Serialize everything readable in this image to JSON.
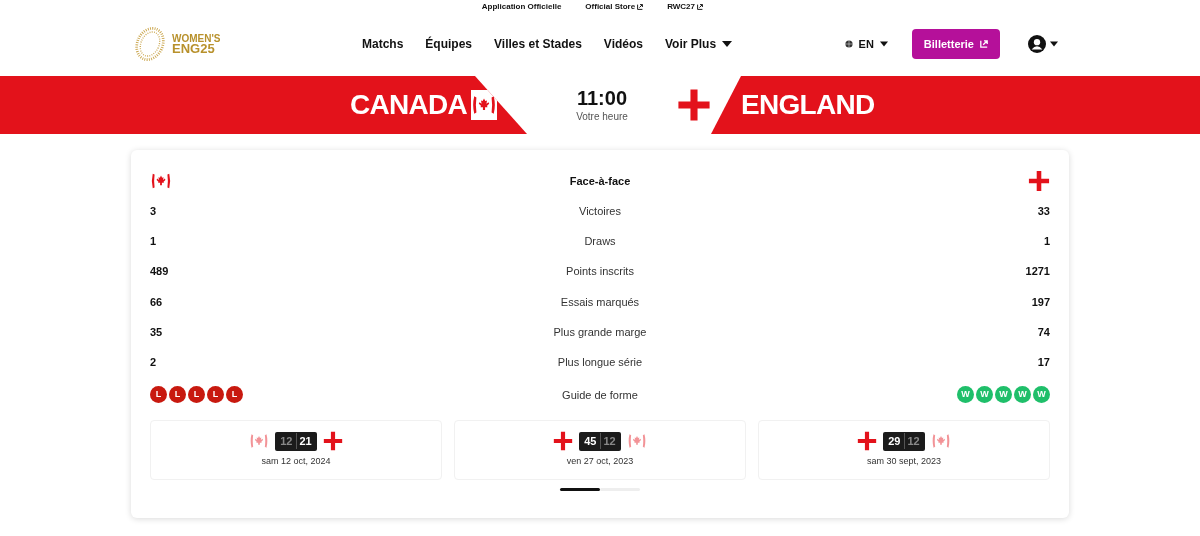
{
  "top_links": [
    {
      "label": "Application Officielle",
      "external": false
    },
    {
      "label": "Official Store",
      "external": true
    },
    {
      "label": "RWC27",
      "external": true
    }
  ],
  "logo": {
    "line1": "WOMEN'S",
    "line2": "ENG25"
  },
  "nav": [
    {
      "label": "Matchs",
      "dropdown": false
    },
    {
      "label": "Équipes",
      "dropdown": false
    },
    {
      "label": "Villes et Stades",
      "dropdown": false
    },
    {
      "label": "Vidéos",
      "dropdown": false
    },
    {
      "label": "Voir Plus",
      "dropdown": true
    }
  ],
  "language": "EN",
  "tickets_button": "Billetterie",
  "match": {
    "home": {
      "name": "CANADA",
      "flag": {
        "kind": "canada"
      }
    },
    "away": {
      "name": "ENGLAND",
      "flag": {
        "kind": "england"
      }
    },
    "time": "11:00",
    "time_note": "Votre heure"
  },
  "head_to_head": {
    "title": "Face-à-face",
    "home_flag": {
      "kind": "canada"
    },
    "away_flag": {
      "kind": "england"
    },
    "rows": [
      {
        "home": "3",
        "label": "Victoires",
        "away": "33"
      },
      {
        "home": "1",
        "label": "Draws",
        "away": "1"
      },
      {
        "home": "489",
        "label": "Points inscrits",
        "away": "1271"
      },
      {
        "home": "66",
        "label": "Essais marqués",
        "away": "197"
      },
      {
        "home": "35",
        "label": "Plus grande marge",
        "away": "74"
      },
      {
        "home": "2",
        "label": "Plus longue série",
        "away": "17"
      }
    ],
    "form_label": "Guide de forme",
    "home_form": [
      {
        "result": "L",
        "color": "#c8190f"
      },
      {
        "result": "L",
        "color": "#c8190f"
      },
      {
        "result": "L",
        "color": "#c8190f"
      },
      {
        "result": "L",
        "color": "#c8190f"
      },
      {
        "result": "L",
        "color": "#c8190f"
      }
    ],
    "away_form": [
      {
        "result": "W",
        "color": "#1fbf6a"
      },
      {
        "result": "W",
        "color": "#1fbf6a"
      },
      {
        "result": "W",
        "color": "#1fbf6a"
      },
      {
        "result": "W",
        "color": "#1fbf6a"
      },
      {
        "result": "W",
        "color": "#1fbf6a"
      }
    ]
  },
  "past_matches": [
    {
      "date": "sam 12 oct, 2024",
      "teams": [
        {
          "flag": {
            "kind": "canada"
          },
          "score": "12",
          "won": false
        },
        {
          "flag": {
            "kind": "england"
          },
          "score": "21",
          "won": true
        }
      ]
    },
    {
      "date": "ven 27 oct, 2023",
      "teams": [
        {
          "flag": {
            "kind": "england"
          },
          "score": "45",
          "won": true
        },
        {
          "flag": {
            "kind": "canada"
          },
          "score": "12",
          "won": false
        }
      ]
    },
    {
      "date": "sam 30 sept, 2023",
      "teams": [
        {
          "flag": {
            "kind": "england"
          },
          "score": "29",
          "won": true
        },
        {
          "flag": {
            "kind": "canada"
          },
          "score": "12",
          "won": false
        }
      ]
    }
  ],
  "pager": [
    {
      "selected": true
    },
    {
      "selected": false
    }
  ]
}
